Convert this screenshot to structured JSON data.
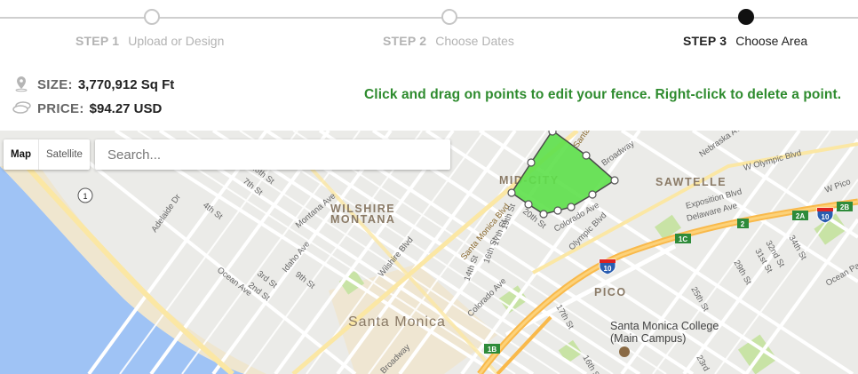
{
  "steps": [
    {
      "num": "STEP 1",
      "label": "Upload or Design"
    },
    {
      "num": "STEP 2",
      "label": "Choose Dates"
    },
    {
      "num": "STEP 3",
      "label": "Choose Area"
    }
  ],
  "summary": {
    "size_label": "SIZE:",
    "size_value": "3,770,912 Sq Ft",
    "price_label": "PRICE:",
    "price_value": "$94.27 USD"
  },
  "hint": "Click and drag on points to edit your fence. Right-click to delete a point.",
  "map": {
    "type_options": [
      "Map",
      "Satellite"
    ],
    "selected_type": "Map",
    "search_placeholder": "Search...",
    "district_labels": {
      "mid_city": "MID-CITY",
      "sawtelle": "SAWTELLE",
      "wilshire_montana_1": "WILSHIRE",
      "wilshire_montana_2": "MONTANA",
      "pico": "PICO",
      "santa_monica": "Santa Monica",
      "college_1": "Santa Monica College",
      "college_2": "(Main Campus)"
    },
    "street_labels": {
      "ocean_ave": "Ocean Ave",
      "adelaide": "Adelaide Dr",
      "fourth_a": "4th St",
      "fourth_b": "4th St",
      "seventh": "7th St",
      "twentysixth": "26th St",
      "montana": "Montana Ave",
      "idaho": "Idaho Ave",
      "ninth": "9th St",
      "third": "3rd St",
      "second": "2nd St",
      "wilshire": "Wilshire Blvd",
      "santa_monica_blvd": "Santa Monica Blvd",
      "twentieth": "20th St",
      "nineteenth": "19th St",
      "seventeenth": "17th St",
      "sixteenth": "16th St",
      "fourteenth": "14th St",
      "colorado_a": "Colorado Ave",
      "colorado_b": "Colorado Ave",
      "olympic": "Olympic Blvd",
      "broadway_a": "Broadway",
      "broadway_b": "Broadway",
      "santa_top": "Santa",
      "nebraska": "Nebraska Ave",
      "w_olympic": "W Olympic Blvd",
      "w_pico": "W Pico",
      "ocean_park": "Ocean Park",
      "exposition": "Exposition Blvd",
      "delaware": "Delaware Ave",
      "thirtysecond": "32nd St",
      "thirtyfirst": "31st St",
      "thirtyfourth": "34th St",
      "twentyninth": "29th St",
      "twentyfifth": "25th St",
      "seventeenth_b": "17th St",
      "sixteenth_b": "16th St",
      "twentythird": "23rd"
    },
    "shields": {
      "route_1": "1",
      "i10_a": "10",
      "i10_b": "10",
      "exit_1b": "1B",
      "exit_1c": "1C",
      "exit_2": "2",
      "exit_2a": "2A",
      "exit_2b": "2B"
    },
    "colors": {
      "water": "#9fc3f5",
      "land": "#ebebe8",
      "park": "#c8e3a5",
      "highway": "#f9b94a",
      "fence_fill": "#5de04a",
      "fence_stroke": "#4a4a4a"
    }
  }
}
